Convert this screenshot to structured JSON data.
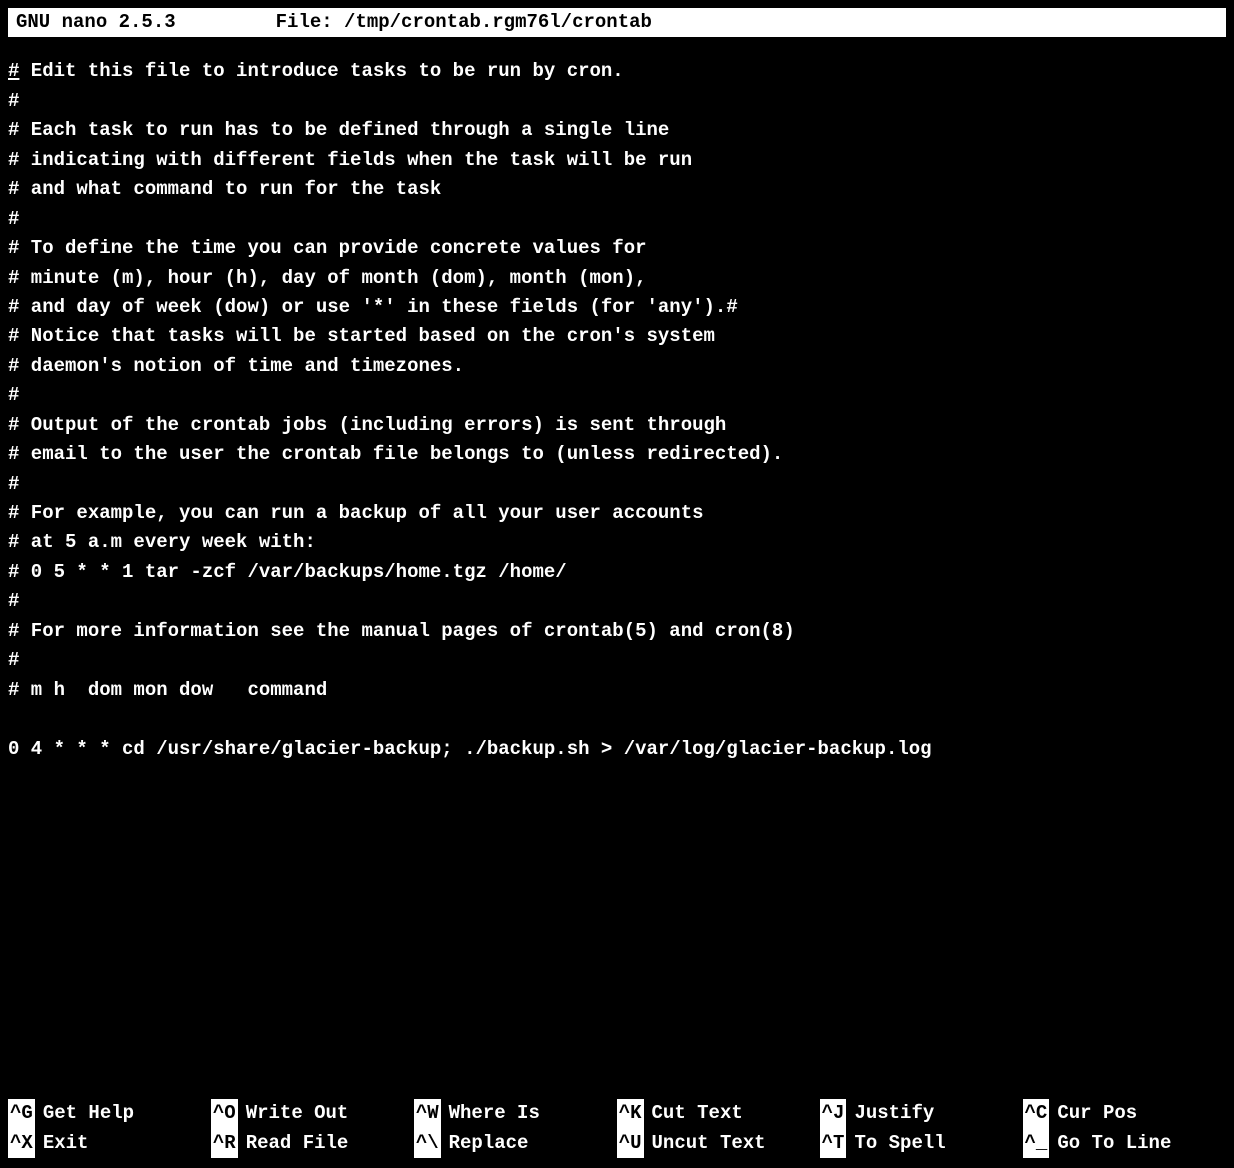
{
  "titlebar": {
    "app": "GNU nano 2.5.3",
    "file_label": "File: /tmp/crontab.rgm76l/crontab"
  },
  "lines": [
    "# Edit this file to introduce tasks to be run by cron.",
    "#",
    "# Each task to run has to be defined through a single line",
    "# indicating with different fields when the task will be run",
    "# and what command to run for the task",
    "#",
    "# To define the time you can provide concrete values for",
    "# minute (m), hour (h), day of month (dom), month (mon),",
    "# and day of week (dow) or use '*' in these fields (for 'any').#",
    "# Notice that tasks will be started based on the cron's system",
    "# daemon's notion of time and timezones.",
    "#",
    "# Output of the crontab jobs (including errors) is sent through",
    "# email to the user the crontab file belongs to (unless redirected).",
    "#",
    "# For example, you can run a backup of all your user accounts",
    "# at 5 a.m every week with:",
    "# 0 5 * * 1 tar -zcf /var/backups/home.tgz /home/",
    "#",
    "# For more information see the manual pages of crontab(5) and cron(8)",
    "#",
    "# m h  dom mon dow   command",
    "",
    "0 4 * * * cd /usr/share/glacier-backup; ./backup.sh > /var/log/glacier-backup.log"
  ],
  "shortcut_rows": [
    [
      {
        "key": "^G",
        "label": "Get Help"
      },
      {
        "key": "^O",
        "label": "Write Out"
      },
      {
        "key": "^W",
        "label": "Where Is"
      },
      {
        "key": "^K",
        "label": "Cut Text"
      },
      {
        "key": "^J",
        "label": "Justify"
      },
      {
        "key": "^C",
        "label": "Cur Pos"
      }
    ],
    [
      {
        "key": "^X",
        "label": "Exit"
      },
      {
        "key": "^R",
        "label": "Read File"
      },
      {
        "key": "^\\",
        "label": "Replace"
      },
      {
        "key": "^U",
        "label": "Uncut Text"
      },
      {
        "key": "^T",
        "label": "To Spell"
      },
      {
        "key": "^_",
        "label": "Go To Line"
      }
    ]
  ]
}
